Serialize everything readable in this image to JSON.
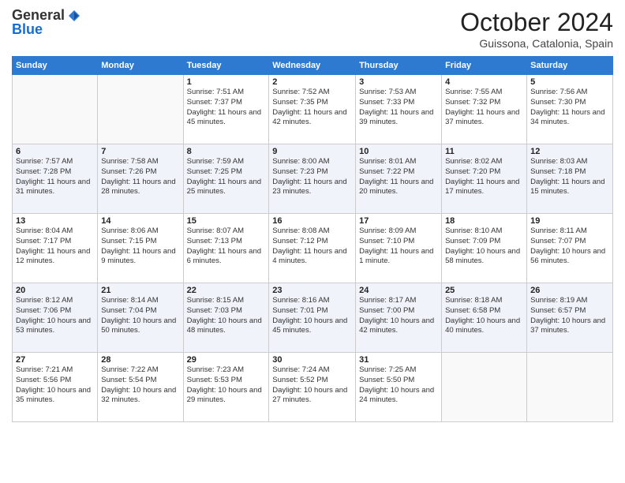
{
  "header": {
    "logo_general": "General",
    "logo_blue": "Blue",
    "month": "October 2024",
    "location": "Guissona, Catalonia, Spain"
  },
  "days_of_week": [
    "Sunday",
    "Monday",
    "Tuesday",
    "Wednesday",
    "Thursday",
    "Friday",
    "Saturday"
  ],
  "weeks": [
    [
      {
        "day": "",
        "info": ""
      },
      {
        "day": "",
        "info": ""
      },
      {
        "day": "1",
        "info": "Sunrise: 7:51 AM\nSunset: 7:37 PM\nDaylight: 11 hours and 45 minutes."
      },
      {
        "day": "2",
        "info": "Sunrise: 7:52 AM\nSunset: 7:35 PM\nDaylight: 11 hours and 42 minutes."
      },
      {
        "day": "3",
        "info": "Sunrise: 7:53 AM\nSunset: 7:33 PM\nDaylight: 11 hours and 39 minutes."
      },
      {
        "day": "4",
        "info": "Sunrise: 7:55 AM\nSunset: 7:32 PM\nDaylight: 11 hours and 37 minutes."
      },
      {
        "day": "5",
        "info": "Sunrise: 7:56 AM\nSunset: 7:30 PM\nDaylight: 11 hours and 34 minutes."
      }
    ],
    [
      {
        "day": "6",
        "info": "Sunrise: 7:57 AM\nSunset: 7:28 PM\nDaylight: 11 hours and 31 minutes."
      },
      {
        "day": "7",
        "info": "Sunrise: 7:58 AM\nSunset: 7:26 PM\nDaylight: 11 hours and 28 minutes."
      },
      {
        "day": "8",
        "info": "Sunrise: 7:59 AM\nSunset: 7:25 PM\nDaylight: 11 hours and 25 minutes."
      },
      {
        "day": "9",
        "info": "Sunrise: 8:00 AM\nSunset: 7:23 PM\nDaylight: 11 hours and 23 minutes."
      },
      {
        "day": "10",
        "info": "Sunrise: 8:01 AM\nSunset: 7:22 PM\nDaylight: 11 hours and 20 minutes."
      },
      {
        "day": "11",
        "info": "Sunrise: 8:02 AM\nSunset: 7:20 PM\nDaylight: 11 hours and 17 minutes."
      },
      {
        "day": "12",
        "info": "Sunrise: 8:03 AM\nSunset: 7:18 PM\nDaylight: 11 hours and 15 minutes."
      }
    ],
    [
      {
        "day": "13",
        "info": "Sunrise: 8:04 AM\nSunset: 7:17 PM\nDaylight: 11 hours and 12 minutes."
      },
      {
        "day": "14",
        "info": "Sunrise: 8:06 AM\nSunset: 7:15 PM\nDaylight: 11 hours and 9 minutes."
      },
      {
        "day": "15",
        "info": "Sunrise: 8:07 AM\nSunset: 7:13 PM\nDaylight: 11 hours and 6 minutes."
      },
      {
        "day": "16",
        "info": "Sunrise: 8:08 AM\nSunset: 7:12 PM\nDaylight: 11 hours and 4 minutes."
      },
      {
        "day": "17",
        "info": "Sunrise: 8:09 AM\nSunset: 7:10 PM\nDaylight: 11 hours and 1 minute."
      },
      {
        "day": "18",
        "info": "Sunrise: 8:10 AM\nSunset: 7:09 PM\nDaylight: 10 hours and 58 minutes."
      },
      {
        "day": "19",
        "info": "Sunrise: 8:11 AM\nSunset: 7:07 PM\nDaylight: 10 hours and 56 minutes."
      }
    ],
    [
      {
        "day": "20",
        "info": "Sunrise: 8:12 AM\nSunset: 7:06 PM\nDaylight: 10 hours and 53 minutes."
      },
      {
        "day": "21",
        "info": "Sunrise: 8:14 AM\nSunset: 7:04 PM\nDaylight: 10 hours and 50 minutes."
      },
      {
        "day": "22",
        "info": "Sunrise: 8:15 AM\nSunset: 7:03 PM\nDaylight: 10 hours and 48 minutes."
      },
      {
        "day": "23",
        "info": "Sunrise: 8:16 AM\nSunset: 7:01 PM\nDaylight: 10 hours and 45 minutes."
      },
      {
        "day": "24",
        "info": "Sunrise: 8:17 AM\nSunset: 7:00 PM\nDaylight: 10 hours and 42 minutes."
      },
      {
        "day": "25",
        "info": "Sunrise: 8:18 AM\nSunset: 6:58 PM\nDaylight: 10 hours and 40 minutes."
      },
      {
        "day": "26",
        "info": "Sunrise: 8:19 AM\nSunset: 6:57 PM\nDaylight: 10 hours and 37 minutes."
      }
    ],
    [
      {
        "day": "27",
        "info": "Sunrise: 7:21 AM\nSunset: 5:56 PM\nDaylight: 10 hours and 35 minutes."
      },
      {
        "day": "28",
        "info": "Sunrise: 7:22 AM\nSunset: 5:54 PM\nDaylight: 10 hours and 32 minutes."
      },
      {
        "day": "29",
        "info": "Sunrise: 7:23 AM\nSunset: 5:53 PM\nDaylight: 10 hours and 29 minutes."
      },
      {
        "day": "30",
        "info": "Sunrise: 7:24 AM\nSunset: 5:52 PM\nDaylight: 10 hours and 27 minutes."
      },
      {
        "day": "31",
        "info": "Sunrise: 7:25 AM\nSunset: 5:50 PM\nDaylight: 10 hours and 24 minutes."
      },
      {
        "day": "",
        "info": ""
      },
      {
        "day": "",
        "info": ""
      }
    ]
  ]
}
